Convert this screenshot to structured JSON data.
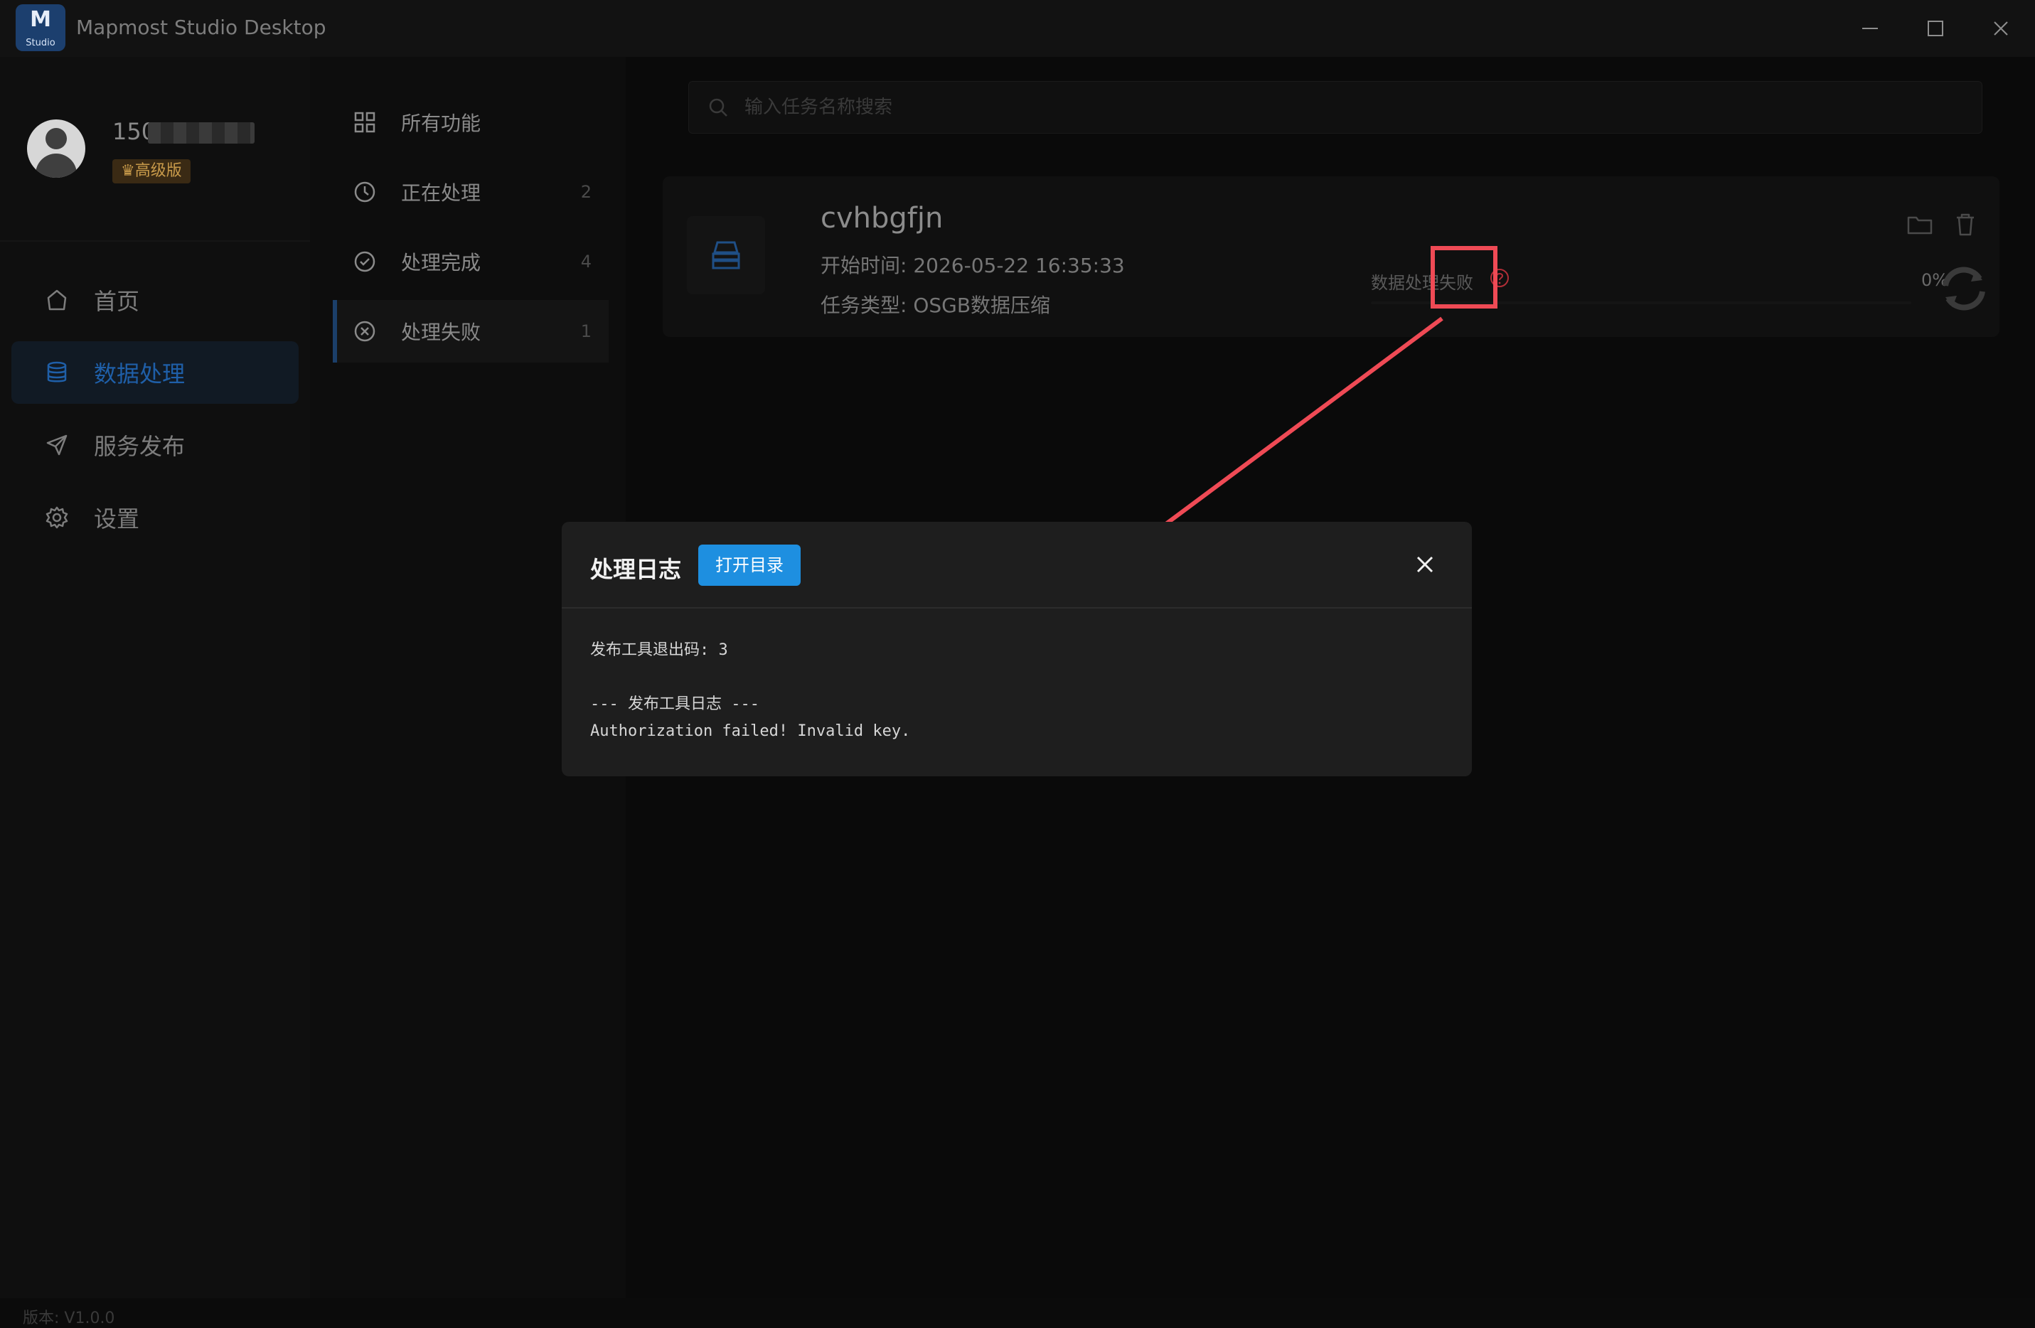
{
  "window": {
    "title": "Mapmost Studio Desktop",
    "logo_mark": "M",
    "logo_sub": "Studio",
    "controls": [
      "minimize-icon",
      "maximize-icon",
      "close-icon"
    ]
  },
  "user": {
    "name_prefix": "150",
    "badge": "♛高级版"
  },
  "nav": {
    "items": [
      {
        "label": "首页",
        "icon": "home-icon",
        "active": false
      },
      {
        "label": "数据处理",
        "icon": "database-icon",
        "active": true
      },
      {
        "label": "服务发布",
        "icon": "send-icon",
        "active": false
      },
      {
        "label": "设置",
        "icon": "gear-icon",
        "active": false
      }
    ],
    "version": "版本: V1.0.0"
  },
  "subnav": {
    "items": [
      {
        "label": "所有功能",
        "count": "",
        "icon": "grid-icon"
      },
      {
        "label": "正在处理",
        "count": "2",
        "icon": "clock-icon"
      },
      {
        "label": "处理完成",
        "count": "4",
        "icon": "check-circle-icon"
      },
      {
        "label": "处理失败",
        "count": "1",
        "icon": "x-circle-icon",
        "active": true
      }
    ]
  },
  "search": {
    "placeholder": "输入任务名称搜索"
  },
  "task": {
    "name": "cvhbgfjn",
    "start_time": "开始时间: 2026-05-22 16:35:33",
    "type": "任务类型: OSGB数据压缩",
    "status": "数据处理失败",
    "percent": "0%",
    "progress": 0,
    "colors": {
      "status_icon": "#c0303a",
      "accent": "#1f5fa8"
    }
  },
  "dialog": {
    "title": "处理日志",
    "open_button": "打开目录",
    "lines": [
      "发布工具退出码: 3",
      "",
      "--- 发布工具日志 ---",
      "Authorization failed! Invalid key."
    ]
  },
  "annotation": {
    "color": "#ef4a55"
  }
}
